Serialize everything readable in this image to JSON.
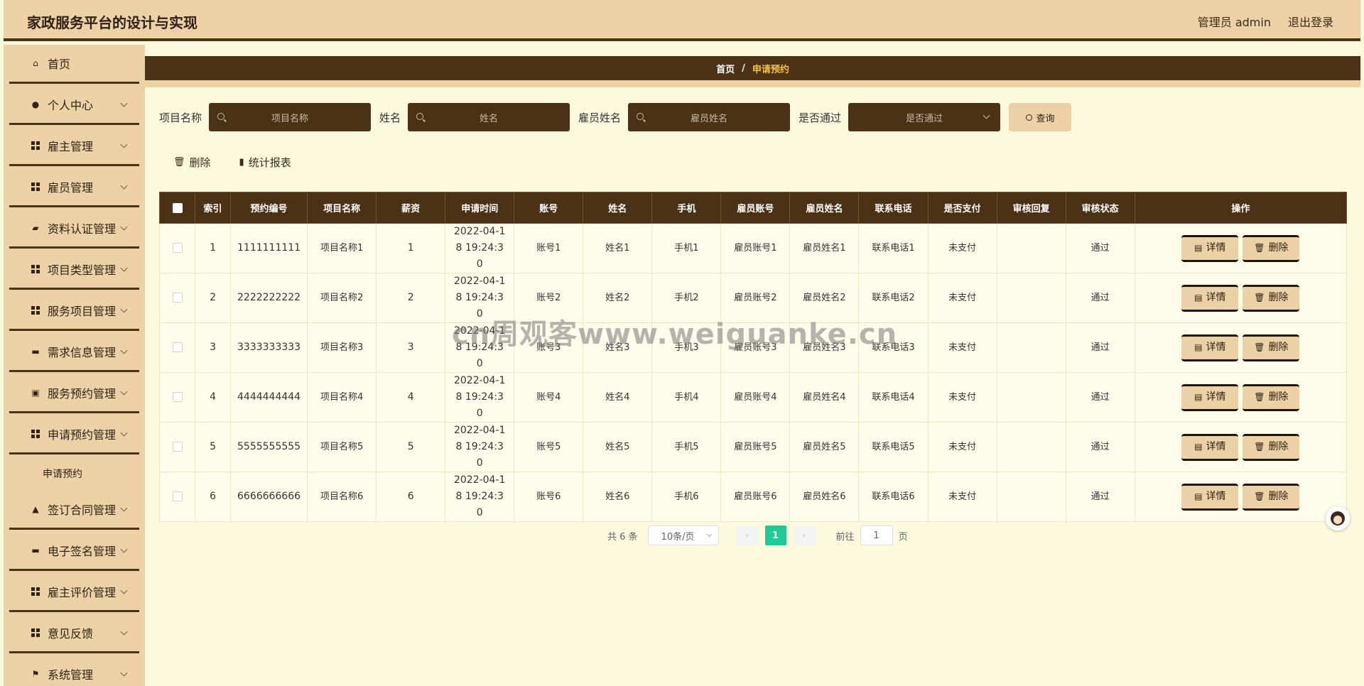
{
  "header": {
    "title": "家政服务平台的设计与实现",
    "user": "管理员 admin",
    "logout": "退出登录"
  },
  "sidebar": {
    "items": [
      {
        "label": "首页",
        "icon": "home-icon"
      },
      {
        "label": "个人中心",
        "icon": "user-icon"
      },
      {
        "label": "雇主管理",
        "icon": "grid-icon"
      },
      {
        "label": "雇员管理",
        "icon": "grid-icon"
      },
      {
        "label": "资料认证管理",
        "icon": "wallet-icon"
      },
      {
        "label": "项目类型管理",
        "icon": "grid-icon"
      },
      {
        "label": "服务项目管理",
        "icon": "grid-icon"
      },
      {
        "label": "需求信息管理",
        "icon": "monitor-icon"
      },
      {
        "label": "服务预约管理",
        "icon": "clipboard-icon"
      },
      {
        "label": "申请预约管理",
        "icon": "grid-icon"
      },
      {
        "label": "签订合同管理",
        "icon": "stamp-icon"
      },
      {
        "label": "电子签名管理",
        "icon": "message-icon"
      },
      {
        "label": "雇主评价管理",
        "icon": "grid-icon"
      },
      {
        "label": "意见反馈",
        "icon": "grid-icon"
      },
      {
        "label": "系统管理",
        "icon": "flag-icon"
      }
    ],
    "subitem": "申请预约"
  },
  "breadcrumb": {
    "home": "首页",
    "separator": "/",
    "current": "申请预约"
  },
  "filters": {
    "project_label": "项目名称",
    "project_placeholder": "项目名称",
    "name_label": "姓名",
    "name_placeholder": "姓名",
    "employee_label": "雇员姓名",
    "employee_placeholder": "雇员姓名",
    "passed_label": "是否通过",
    "passed_placeholder": "是否通过",
    "query": "查询"
  },
  "actions": {
    "delete": "删除",
    "report": "统计报表"
  },
  "table": {
    "headers": [
      "索引",
      "预约编号",
      "项目名称",
      "薪资",
      "申请时间",
      "账号",
      "姓名",
      "手机",
      "雇员账号",
      "雇员姓名",
      "联系电话",
      "是否支付",
      "审核回复",
      "审核状态",
      "操作"
    ],
    "rows": [
      [
        "1",
        "1111111111",
        "项目名称1",
        "1",
        "2022-04-18 19:24:30",
        "账号1",
        "姓名1",
        "手机1",
        "雇员账号1",
        "雇员姓名1",
        "联系电话1",
        "未支付",
        "",
        "通过"
      ],
      [
        "2",
        "2222222222",
        "项目名称2",
        "2",
        "2022-04-18 19:24:30",
        "账号2",
        "姓名2",
        "手机2",
        "雇员账号2",
        "雇员姓名2",
        "联系电话2",
        "未支付",
        "",
        "通过"
      ],
      [
        "3",
        "3333333333",
        "项目名称3",
        "3",
        "2022-04-18 19:24:30",
        "账号3",
        "姓名3",
        "手机3",
        "雇员账号3",
        "雇员姓名3",
        "联系电话3",
        "未支付",
        "",
        "通过"
      ],
      [
        "4",
        "4444444444",
        "项目名称4",
        "4",
        "2022-04-18 19:24:30",
        "账号4",
        "姓名4",
        "手机4",
        "雇员账号4",
        "雇员姓名4",
        "联系电话4",
        "未支付",
        "",
        "通过"
      ],
      [
        "5",
        "5555555555",
        "项目名称5",
        "5",
        "2022-04-18 19:24:30",
        "账号5",
        "姓名5",
        "手机5",
        "雇员账号5",
        "雇员姓名5",
        "联系电话5",
        "未支付",
        "",
        "通过"
      ],
      [
        "6",
        "6666666666",
        "项目名称6",
        "6",
        "2022-04-18 19:24:30",
        "账号6",
        "姓名6",
        "手机6",
        "雇员账号6",
        "雇员姓名6",
        "联系电话6",
        "未支付",
        "",
        "通过"
      ]
    ],
    "detail_btn": "详情",
    "delete_btn": "删除"
  },
  "pagination": {
    "total": "共 6 条",
    "page_size": "10条/页",
    "current_page": "1",
    "goto_label": "前往",
    "goto_value": "1",
    "page_suffix": "页"
  },
  "watermark": "cn周观客www.weiguanke.cn"
}
